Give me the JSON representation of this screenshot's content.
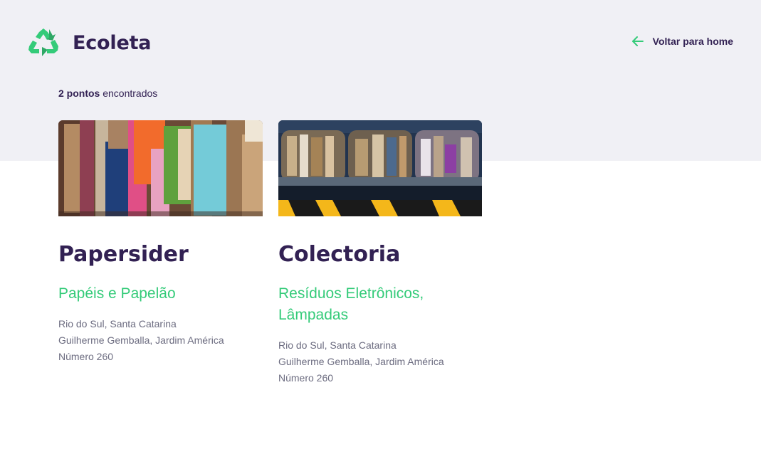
{
  "header": {
    "app_name": "Ecoleta",
    "logo_icon": "recycle-icon",
    "back_label": "Voltar para home",
    "back_icon": "arrow-left-icon"
  },
  "results": {
    "count_bold": "2 pontos",
    "count_rest": " encontrados"
  },
  "points": [
    {
      "name": "Papersider",
      "items": "Papéis e Papelão",
      "city_state": "Rio do Sul, Santa Catarina",
      "street": "Guilherme Gemballa, Jardim América",
      "number": "Número 260",
      "image": "bales-of-paper-and-cardboard"
    },
    {
      "name": "Colectoria",
      "items": "Resíduos Eletrônicos, Lâmpadas",
      "city_state": "Rio do Sul, Santa Catarina",
      "street": "Guilherme Gemballa, Jardim América",
      "number": "Número 260",
      "image": "recycling-bins-with-cardboard"
    }
  ],
  "colors": {
    "primary": "#34cb79",
    "title": "#322153",
    "text": "#6c6c80",
    "background": "#f0f0f5"
  }
}
